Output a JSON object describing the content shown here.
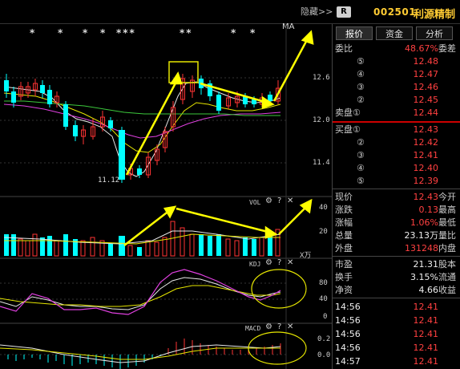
{
  "header": {
    "stars_group1": [
      "*",
      "*",
      "*",
      "*"
    ],
    "stars_group2": "***",
    "stars_group3": "**",
    "stars_group4": [
      "*",
      "*"
    ],
    "ma_label": "MA",
    "hide_button": "隐藏>>",
    "r_badge": "R",
    "stock_code": "002501",
    "stock_name": "利源精制"
  },
  "price_chart": {
    "y_ticks": [
      "12.6",
      "12.0",
      "11.4"
    ],
    "low_label": "11.12"
  },
  "volume_panel": {
    "title": "VOL",
    "y_ticks": [
      "40",
      "20"
    ],
    "unit": "X万"
  },
  "kdj_panel": {
    "title": "KDJ",
    "y_ticks": [
      "80",
      "40",
      "0"
    ]
  },
  "macd_panel": {
    "title": "MACD",
    "y_ticks": [
      "0.2",
      "0.0"
    ]
  },
  "toolbar_icons": {
    "gear": "⚙",
    "help": "?",
    "close": "✕"
  },
  "tabs": [
    "报价",
    "资金",
    "分析"
  ],
  "order_book": {
    "weibi_label": "委比",
    "weibi_value": "48.67%",
    "weicha_label": "委差",
    "asks": [
      {
        "num": "⑤",
        "price": "12.48"
      },
      {
        "num": "④",
        "price": "12.47"
      },
      {
        "num": "③",
        "price": "12.46"
      },
      {
        "num": "②",
        "price": "12.45"
      },
      {
        "label": "卖盘①",
        "price": "12.44"
      }
    ],
    "bids": [
      {
        "label": "买盘①",
        "price": "12.43"
      },
      {
        "num": "②",
        "price": "12.42"
      },
      {
        "num": "③",
        "price": "12.41"
      },
      {
        "num": "④",
        "price": "12.40"
      },
      {
        "num": "⑤",
        "price": "12.39"
      }
    ]
  },
  "quote": [
    {
      "label": "现价",
      "value": "12.43",
      "tail": "今开",
      "color": "red"
    },
    {
      "label": "涨跌",
      "value": "0.13",
      "tail": "最高",
      "color": "red"
    },
    {
      "label": "涨幅",
      "value": "1.06%",
      "tail": "最低",
      "color": "red"
    },
    {
      "label": "总量",
      "value": "23.13万",
      "tail": "量比",
      "color": "white"
    },
    {
      "label": "外盘",
      "value": "131248",
      "tail": "内盘",
      "color": "red"
    },
    {
      "label": "市盈",
      "value": "21.31",
      "tail": "股本",
      "color": "white"
    },
    {
      "label": "换手",
      "value": "3.15%",
      "tail": "流通",
      "color": "white"
    },
    {
      "label": "净资",
      "value": "4.66",
      "tail": "收益",
      "color": "white"
    }
  ],
  "ticks": [
    {
      "time": "14:56",
      "price": "12.41"
    },
    {
      "time": "14:56",
      "price": "12.41"
    },
    {
      "time": "14:56",
      "price": "12.41"
    },
    {
      "time": "14:56",
      "price": "12.41"
    },
    {
      "time": "14:57",
      "price": "12.41"
    }
  ],
  "colors": {
    "up": "#ff3333",
    "down": "#00ffff",
    "accent": "#ffff00",
    "background": "#000000"
  }
}
